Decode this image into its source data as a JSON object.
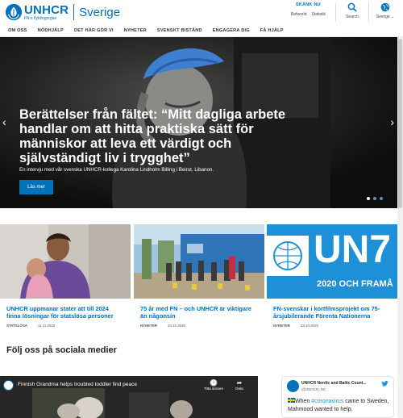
{
  "header": {
    "logo_name": "UNHCR",
    "logo_sub": "FN:s flyktingorgan",
    "country": "Sverige",
    "give_label": "SKÄNK NU",
    "links": [
      "Refworld",
      "Statistik"
    ],
    "search_label": "Search",
    "region_label": "Sverige"
  },
  "nav": {
    "items": [
      "OM OSS",
      "NÖDHJÄLP",
      "DET HÄR GÖR VI",
      "NYHETER",
      "SVENSKT BISTÅND",
      "ENGAGERA DIG",
      "FÅ HJÄLP"
    ]
  },
  "hero": {
    "title": "Berättelser från fältet: “Mitt dagliga arbete handlar om att hitta praktiska sätt för människor att leva ett värdigt och självständigt liv i trygghet”",
    "subtitle": "En intervju med vår svenska UNHCR-kollega  Karolina Lindholm Billing i  Beirut,  Libanon.",
    "button": "Läs mer",
    "prev_arrow": "‹",
    "next_arrow": "›",
    "slides": 3,
    "active_slide": 1
  },
  "cards": [
    {
      "title": "UNHCR uppmanar stater att till 2024 finna lösningar för statslösa personer",
      "category": "STATSLÖSA",
      "date": "11.11.2020"
    },
    {
      "title": "75 år med FN – och UNHCR är viktigare än någonsin",
      "category": "NYHETER",
      "date": "23.10.2020"
    },
    {
      "title": "FN-svenskar i kortfilmsprojekt om 75-årsjubilerande Förenta Nationerna",
      "category": "NYHETER",
      "date": "23.10.2020",
      "image_text_1": "UN7",
      "image_text_2": "2020 OCH FRAMÅ"
    }
  ],
  "social": {
    "heading": "Följ oss på sociala medier",
    "video": {
      "title": "Finnish Grandma helps troubled toddler find peace",
      "watch_later": "Titta senare",
      "share": "Dela"
    },
    "tweet": {
      "account_name": "UNHCR Nordic and Baltic Count...",
      "handle": "@UNHCR_NE",
      "text_before": "When ",
      "hashtag": "#coronavirus",
      "text_after": " came to Sweden, Mahmood wanted to help."
    }
  },
  "colors": {
    "brand_blue": "#0072bc",
    "twitter_blue": "#1b95e0"
  }
}
